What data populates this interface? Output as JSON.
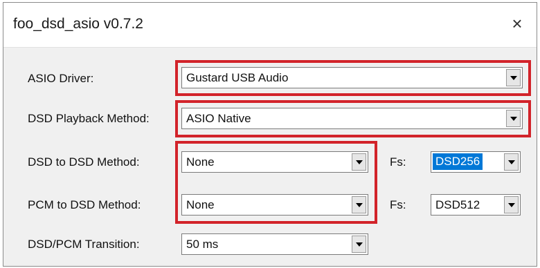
{
  "window": {
    "title": "foo_dsd_asio v0.7.2",
    "close_glyph": "×"
  },
  "fields": {
    "asio_driver": {
      "label": "ASIO Driver:",
      "value": "Gustard USB Audio"
    },
    "dsd_playback_method": {
      "label": "DSD Playback Method:",
      "value": "ASIO Native"
    },
    "dsd_to_dsd_method": {
      "label": "DSD to DSD Method:",
      "value": "None"
    },
    "pcm_to_dsd_method": {
      "label": "PCM to DSD Method:",
      "value": "None"
    },
    "dsd_pcm_transition": {
      "label": "DSD/PCM Transition:",
      "value": "50 ms"
    },
    "fs_dsd_to_dsd": {
      "label": "Fs:",
      "value": "DSD256",
      "selected": true
    },
    "fs_pcm_to_dsd": {
      "label": "Fs:",
      "value": "DSD512"
    }
  },
  "icons": {
    "dropdown": "chevron-down-icon",
    "close": "close-icon"
  },
  "colors": {
    "highlight_box": "#d2232a",
    "selection": "#0078d7"
  }
}
